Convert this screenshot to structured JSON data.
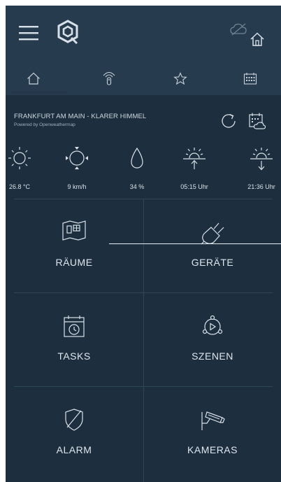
{
  "weather": {
    "title": "FRANKFURT AM MAIN - KLARER HIMMEL",
    "powered_by": "Powered by Openweathermap",
    "items": [
      {
        "icon": "sun-icon",
        "value": "26.8 °C"
      },
      {
        "icon": "wind-compass-icon",
        "value": "9 km/h"
      },
      {
        "icon": "humidity-drop-icon",
        "value": "34 %"
      },
      {
        "icon": "sunrise-icon",
        "value": "05:15 Uhr"
      },
      {
        "icon": "sunset-icon",
        "value": "21:36 Uhr"
      }
    ]
  },
  "tiles": [
    {
      "label": "RÄUME",
      "icon": "floorplan-icon"
    },
    {
      "label": "GERÄTE",
      "icon": "plug-icon"
    },
    {
      "label": "TASKS",
      "icon": "calendar-clock-icon"
    },
    {
      "label": "SZENEN",
      "icon": "scene-play-icon"
    },
    {
      "label": "ALARM",
      "icon": "shield-off-icon"
    },
    {
      "label": "KAMERAS",
      "icon": "security-camera-icon"
    }
  ],
  "colors": {
    "background": "#1d2f3f",
    "bar": "#263b4d",
    "foreground": "#d8e0e7"
  }
}
